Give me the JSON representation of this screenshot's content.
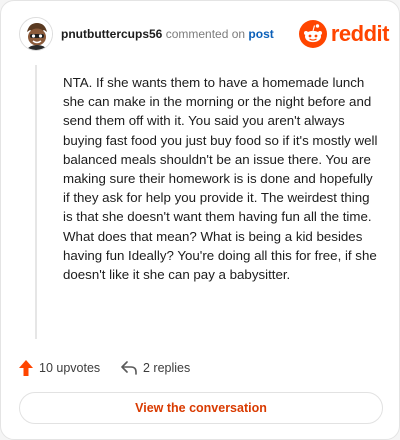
{
  "header": {
    "username": "pnutbuttercups56",
    "action_text": "commented on",
    "post_link": "post",
    "brand_word": "reddit"
  },
  "comment": {
    "text": "NTA. If she wants them to have a homemade lunch she can make in the morning or the night before and send them off with it. You said you aren't always buying fast food you just buy food so if it's mostly well balanced meals shouldn't be an issue there. You are making sure their homework is is done and hopefully if they ask for help you provide it. The weirdest thing is that she doesn't want them having fun all the time. What does that mean? What is being a kid besides having fun Ideally? You're doing all this for free, if she doesn't like it she can pay a babysitter."
  },
  "actions": {
    "upvotes_label": "10 upvotes",
    "replies_label": "2 replies"
  },
  "cta": {
    "label": "View the conversation"
  },
  "icons": {
    "avatar": "avatar-character-icon",
    "brand": "reddit-snoo-icon",
    "upvote": "upvote-arrow-icon",
    "reply": "reply-arrow-icon"
  },
  "colors": {
    "brand": "#ff4500",
    "link": "#0a5fb8",
    "cta_text": "#d93a00",
    "upvote": "#ff4500"
  }
}
